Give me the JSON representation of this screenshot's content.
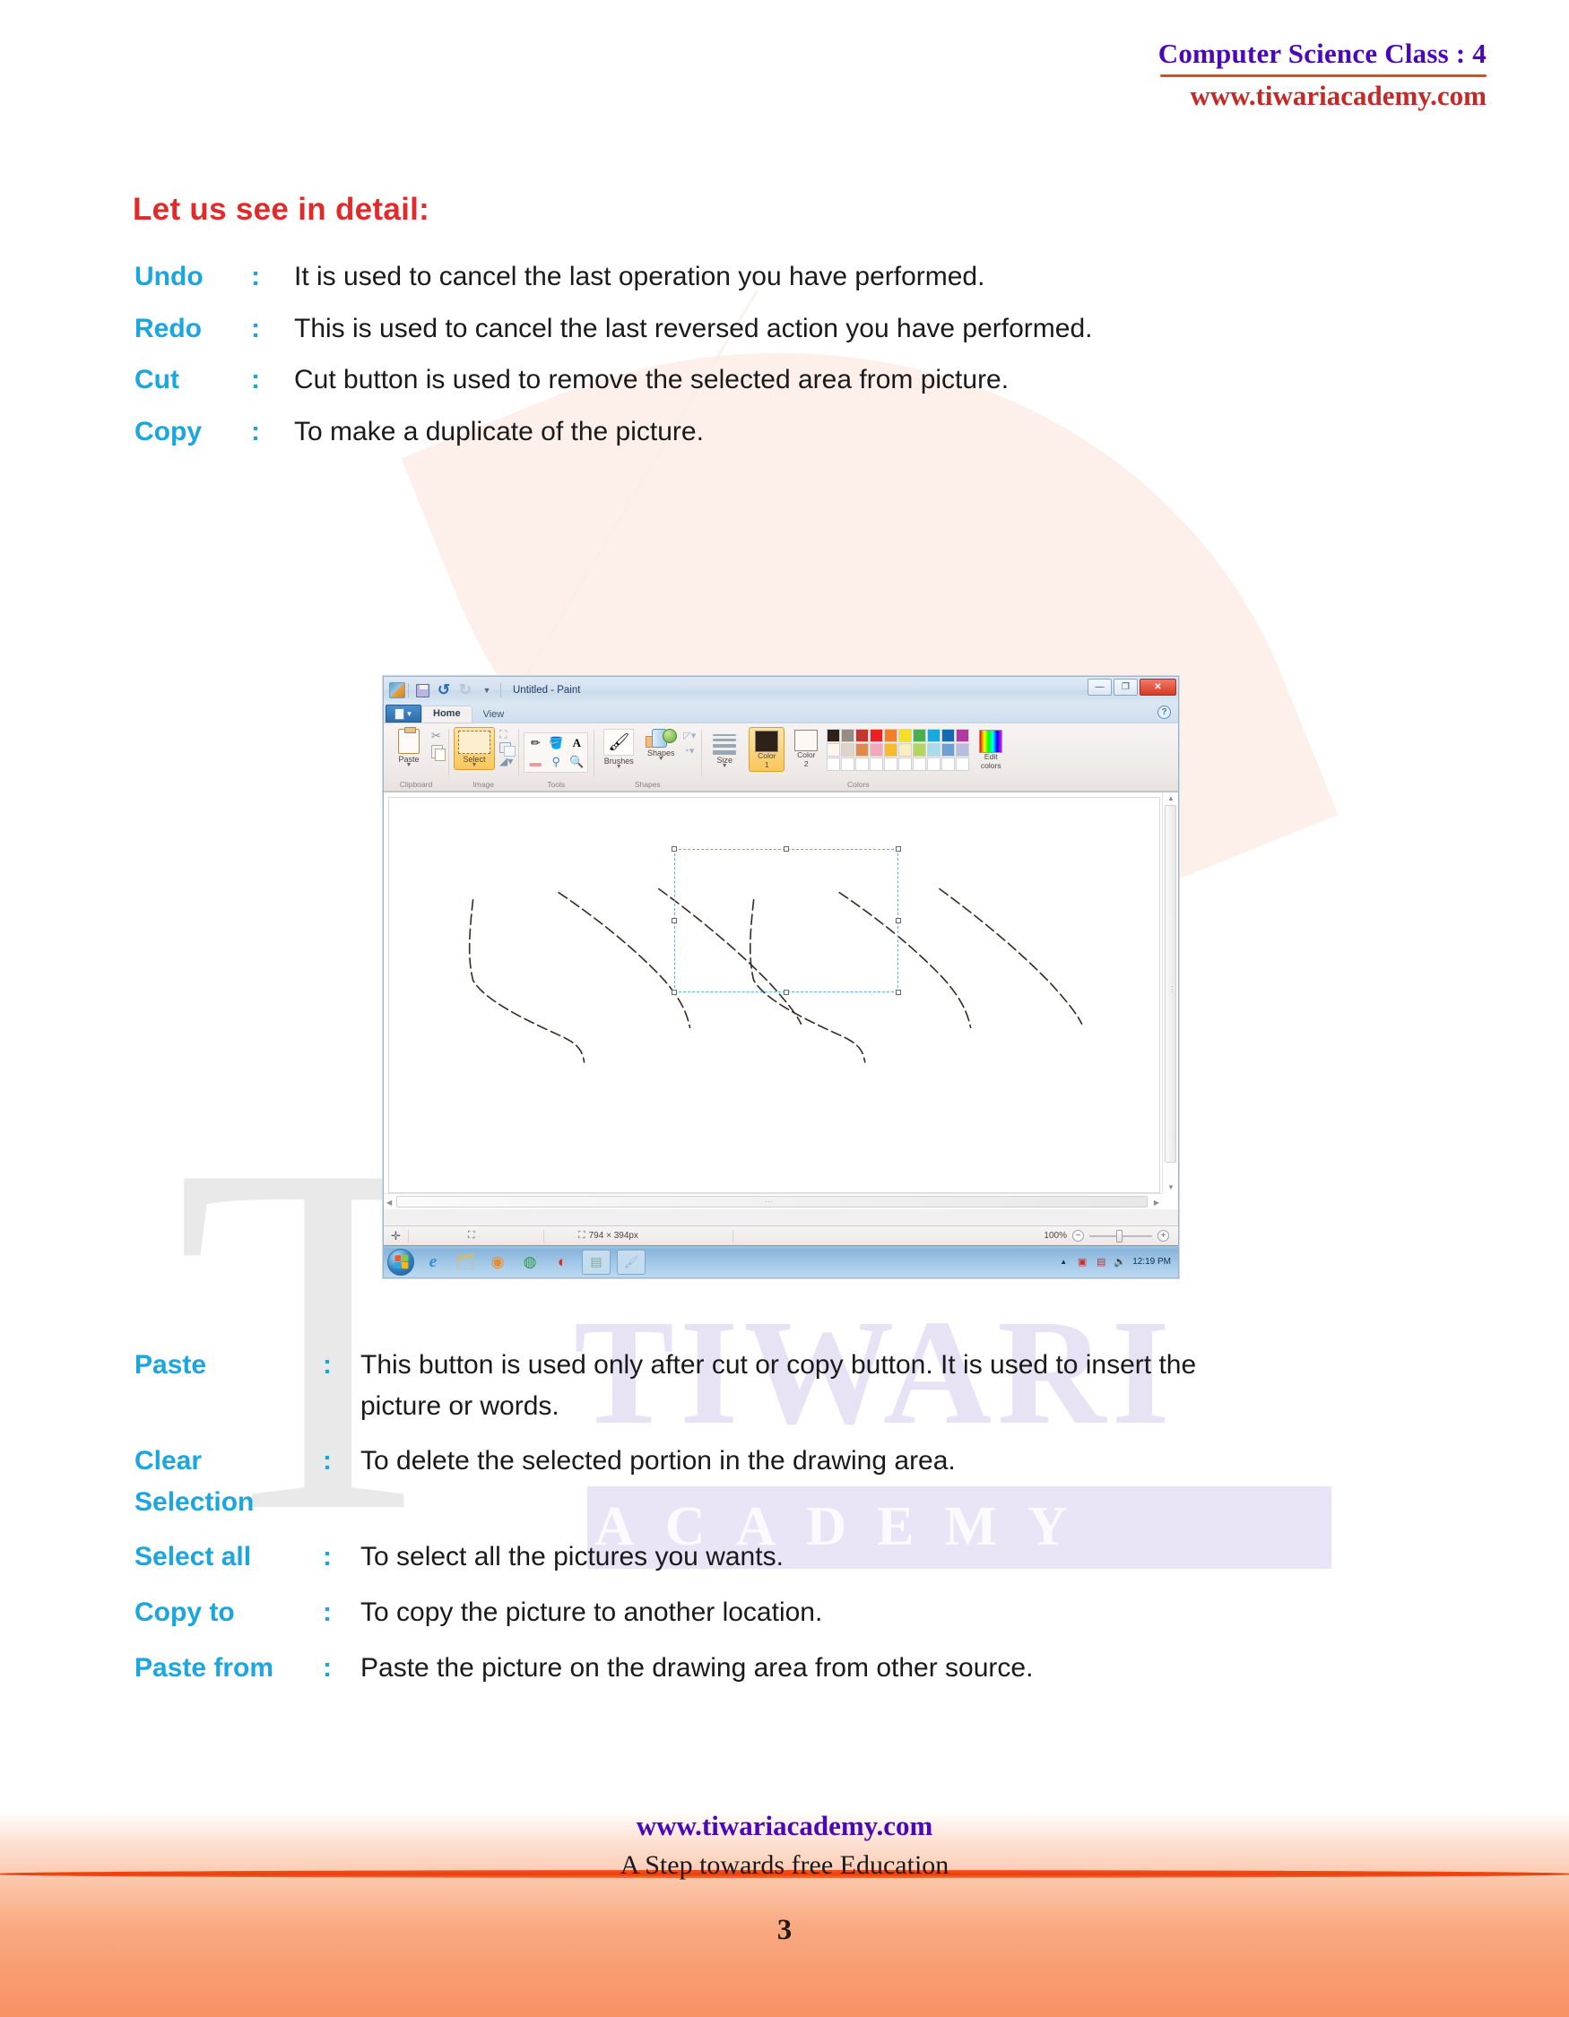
{
  "header": {
    "title": "Computer Science Class : 4",
    "site": "www.tiwariacademy.com"
  },
  "section": {
    "title": "Let us see in detail:"
  },
  "definitions_top": [
    {
      "term": "Undo",
      "colon": ":",
      "text": "It is used to cancel the last operation you have performed."
    },
    {
      "term": "Redo",
      "colon": ":",
      "text": "This is used to cancel the last reversed action you have performed."
    },
    {
      "term": "Cut",
      "colon": ":",
      "text": "Cut button is used to remove the selected area from picture."
    },
    {
      "term": "Copy",
      "colon": ":",
      "text": "To make a duplicate  of the picture."
    }
  ],
  "definitions_bottom": [
    {
      "term": "Paste",
      "colon": ":",
      "text": "This button is used only after cut or copy button. It is used to insert the picture or words."
    },
    {
      "term": "Clear Selection",
      "colon": ":",
      "text": "To delete the selected portion in the drawing area."
    },
    {
      "term": "Select all",
      "colon": ":",
      "text": "To select all the pictures you wants."
    },
    {
      "term": "Copy to",
      "colon": ":",
      "text": "To copy the picture to another location."
    },
    {
      "term": "Paste from",
      "colon": ":",
      "text": "Paste the picture on the drawing area from other source."
    }
  ],
  "watermark": {
    "letter": "T",
    "word": "TIWARI",
    "word2": "ACADEMY"
  },
  "paint": {
    "title": "Untitled - Paint",
    "quick_access": [
      "save-icon",
      "undo-icon",
      "redo-icon",
      "customize-icon"
    ],
    "window_buttons": {
      "minimize": "—",
      "restore": "❐",
      "close": "✕"
    },
    "help": "?",
    "tabs": [
      {
        "label": "Home",
        "active": true
      },
      {
        "label": "View",
        "active": false
      }
    ],
    "groups": [
      {
        "label": "Clipboard",
        "buttons": [
          {
            "label": "Paste",
            "caret": "▼",
            "icon": "clipboard-icon"
          },
          {
            "label": "",
            "icon": "scissors-icon"
          },
          {
            "label": "",
            "icon": "copy-icon"
          }
        ]
      },
      {
        "label": "Image",
        "buttons": [
          {
            "label": "Select",
            "caret": "▼",
            "icon": "selection-rect-icon"
          },
          {
            "label": "",
            "icon": "crop-icon"
          },
          {
            "label": "",
            "icon": "resize-icon"
          },
          {
            "label": "",
            "icon": "rotate-icon"
          }
        ]
      },
      {
        "label": "Tools",
        "tools": [
          "pencil-icon",
          "fill-icon",
          "text-icon",
          "eraser-icon",
          "color-picker-icon",
          "magnifier-icon"
        ]
      },
      {
        "label": "Shapes",
        "buttons": [
          {
            "label": "Brushes",
            "caret": "▼",
            "icon": "brush-icon"
          },
          {
            "label": "Shapes",
            "caret": "▼",
            "icon": "shapes-icon"
          },
          {
            "label": "",
            "icon": "outline-icon"
          },
          {
            "label": "",
            "icon": "fill-shape-icon"
          }
        ]
      },
      {
        "label": "Colors",
        "size_label": "Size",
        "size_caret": "▼",
        "color1_label": "Color\n1",
        "color2_label": "Color\n2",
        "edit_label": "Edit\ncolors"
      }
    ],
    "size_label": "Size",
    "color1": {
      "line1": "Color",
      "line2": "1",
      "value": "#2e2119",
      "selected": true
    },
    "color2": {
      "line1": "Color",
      "line2": "2",
      "value": "#fdf9f2",
      "selected": false
    },
    "edit_colors": {
      "line1": "Edit",
      "line2": "colors"
    },
    "palette_row1": [
      "#2e2119",
      "#968c86",
      "#c2382f",
      "#ec2024",
      "#f07f2a",
      "#f7df26",
      "#4cae4c",
      "#1aa8e0",
      "#1668b0",
      "#b2399f"
    ],
    "palette_row2": [
      "#fdf6ee",
      "#ded4c9",
      "#e08a4c",
      "#f3a8bd",
      "#f9ba2d",
      "#fbedc2",
      "#b3d45e",
      "#a8dbec",
      "#6f9fd0",
      "#b8bcdd"
    ],
    "palette_row3": [
      "#ffffff",
      "#ffffff",
      "#ffffff",
      "#ffffff",
      "#ffffff",
      "#ffffff",
      "#ffffff",
      "#ffffff",
      "#ffffff",
      "#ffffff"
    ],
    "status": {
      "cursor_icon": "crosshair-icon",
      "selection_icon": "selection-size-icon",
      "image_size_icon": "image-size-icon",
      "image_size": "794 × 394px",
      "zoom": "100%",
      "zoom_out": "−",
      "zoom_in": "+"
    },
    "taskbar": {
      "start": "windows-start-orb",
      "items": [
        "internet-explorer-icon",
        "explorer-icon",
        "media-player-icon",
        "chrome-icon",
        "opera-icon",
        "app-window-icon",
        "paint-window-icon"
      ],
      "tray": [
        "show-hidden-icon",
        "antivirus-icon",
        "flash-icon",
        "volume-icon"
      ],
      "clock": "12:19 PM"
    }
  },
  "footer": {
    "site": "www.tiwariacademy.com",
    "tagline": "A Step towards free Education",
    "page_number": "3"
  }
}
